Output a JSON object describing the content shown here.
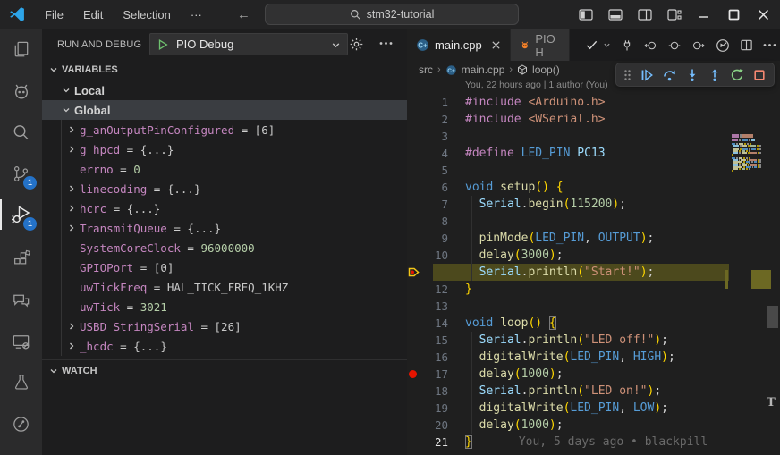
{
  "window": {
    "menus": [
      "File",
      "Edit",
      "Selection",
      "···"
    ],
    "search_label": "stm32-tutorial"
  },
  "activity_bar": {
    "badges": {
      "scm": "1",
      "debug": "1"
    },
    "icons": [
      "files",
      "platformio-alien",
      "search",
      "source-control",
      "run-and-debug",
      "extensions",
      "comments",
      "remote-explorer",
      "testing-beaker",
      "share-circle"
    ]
  },
  "sidebar": {
    "title": "RUN AND DEBUG",
    "launch_config": "PIO Debug",
    "sections": {
      "variables": "VARIABLES",
      "watch": "WATCH"
    },
    "scopes": [
      {
        "label": "Local",
        "selected": false
      },
      {
        "label": "Global",
        "selected": true
      }
    ],
    "variables": [
      {
        "expand": true,
        "name": "g_anOutputPinConfigured",
        "value": "[6]",
        "vclass": "plain"
      },
      {
        "expand": true,
        "name": "g_hpcd",
        "value": "{...}",
        "vclass": "plain"
      },
      {
        "expand": false,
        "name": "errno",
        "value": "0",
        "vclass": "num"
      },
      {
        "expand": true,
        "name": "linecoding",
        "value": "{...}",
        "vclass": "plain"
      },
      {
        "expand": true,
        "name": "hcrc",
        "value": "{...}",
        "vclass": "plain"
      },
      {
        "expand": true,
        "name": "TransmitQueue",
        "value": "{...}",
        "vclass": "plain"
      },
      {
        "expand": false,
        "name": "SystemCoreClock",
        "value": "96000000",
        "vclass": "num"
      },
      {
        "expand": false,
        "name": "GPIOPort",
        "value": "[0]",
        "vclass": "plain"
      },
      {
        "expand": false,
        "name": "uwTickFreq",
        "value": "HAL_TICK_FREQ_1KHZ",
        "vclass": "plain"
      },
      {
        "expand": false,
        "name": "uwTick",
        "value": "3021",
        "vclass": "num"
      },
      {
        "expand": true,
        "name": "USBD_StringSerial",
        "value": "[26]",
        "vclass": "plain"
      },
      {
        "expand": true,
        "name": "_hcdc",
        "value": "{...}",
        "vclass": "plain"
      }
    ]
  },
  "editor": {
    "tabs": [
      {
        "label": "main.cpp",
        "active": true
      },
      {
        "label": "PIO H",
        "active": false
      }
    ],
    "breadcrumbs": [
      "src",
      "main.cpp",
      "loop()"
    ],
    "codelens": "You, 22 hours ago | 1 author (You)",
    "current_line": 11,
    "breakpoint_line": 17,
    "cursor_line": 21,
    "ruler_label": "T",
    "lines": [
      {
        "n": 1,
        "t": [
          [
            "#include",
            "pp"
          ],
          [
            " ",
            "pun"
          ],
          [
            "<Arduino.h>",
            "str"
          ]
        ]
      },
      {
        "n": 2,
        "t": [
          [
            "#include",
            "pp"
          ],
          [
            " ",
            "pun"
          ],
          [
            "<WSerial.h>",
            "str"
          ]
        ]
      },
      {
        "n": 3,
        "t": []
      },
      {
        "n": 4,
        "t": [
          [
            "#define",
            "pp"
          ],
          [
            " ",
            "pun"
          ],
          [
            "LED_PIN",
            "kw"
          ],
          [
            " ",
            "pun"
          ],
          [
            "PC13",
            "var"
          ]
        ]
      },
      {
        "n": 5,
        "t": []
      },
      {
        "n": 6,
        "t": [
          [
            "void",
            "kw"
          ],
          [
            " ",
            "pun"
          ],
          [
            "setup",
            "fn"
          ],
          [
            "()",
            "br"
          ],
          [
            " ",
            "pun"
          ],
          [
            "{",
            "br"
          ]
        ]
      },
      {
        "n": 7,
        "t": [
          [
            "  ",
            "ind"
          ],
          [
            "Serial",
            "var"
          ],
          [
            ".",
            "pun"
          ],
          [
            "begin",
            "fn"
          ],
          [
            "(",
            "br"
          ],
          [
            "115200",
            "num"
          ],
          [
            ")",
            "br"
          ],
          [
            ";",
            "pun"
          ]
        ]
      },
      {
        "n": 8,
        "t": [
          [
            "  ",
            "ind"
          ]
        ]
      },
      {
        "n": 9,
        "t": [
          [
            "  ",
            "ind"
          ],
          [
            "pinMode",
            "fn"
          ],
          [
            "(",
            "br"
          ],
          [
            "LED_PIN",
            "kw"
          ],
          [
            ", ",
            "pun"
          ],
          [
            "OUTPUT",
            "kw"
          ],
          [
            ")",
            "br"
          ],
          [
            ";",
            "pun"
          ]
        ]
      },
      {
        "n": 10,
        "t": [
          [
            "  ",
            "ind"
          ],
          [
            "delay",
            "fn"
          ],
          [
            "(",
            "br"
          ],
          [
            "3000",
            "num"
          ],
          [
            ")",
            "br"
          ],
          [
            ";",
            "pun"
          ]
        ]
      },
      {
        "n": 11,
        "t": [
          [
            "  ",
            "ind"
          ],
          [
            "Serial",
            "var"
          ],
          [
            ".",
            "pun"
          ],
          [
            "println",
            "fn"
          ],
          [
            "(",
            "br"
          ],
          [
            "\"Start!\"",
            "str"
          ],
          [
            ")",
            "br"
          ],
          [
            ";",
            "pun"
          ]
        ]
      },
      {
        "n": 12,
        "t": [
          [
            "}",
            "br"
          ]
        ]
      },
      {
        "n": 13,
        "t": []
      },
      {
        "n": 14,
        "t": [
          [
            "void",
            "kw"
          ],
          [
            " ",
            "pun"
          ],
          [
            "loop",
            "fn"
          ],
          [
            "()",
            "br"
          ],
          [
            " ",
            "pun"
          ],
          [
            "{",
            "brbox"
          ]
        ]
      },
      {
        "n": 15,
        "t": [
          [
            "  ",
            "ind"
          ],
          [
            "Serial",
            "var"
          ],
          [
            ".",
            "pun"
          ],
          [
            "println",
            "fn"
          ],
          [
            "(",
            "br"
          ],
          [
            "\"LED off!\"",
            "str"
          ],
          [
            ")",
            "br"
          ],
          [
            ";",
            "pun"
          ]
        ]
      },
      {
        "n": 16,
        "t": [
          [
            "  ",
            "ind"
          ],
          [
            "digitalWrite",
            "fn"
          ],
          [
            "(",
            "br"
          ],
          [
            "LED_PIN",
            "kw"
          ],
          [
            ", ",
            "pun"
          ],
          [
            "HIGH",
            "kw"
          ],
          [
            ")",
            "br"
          ],
          [
            ";",
            "pun"
          ]
        ]
      },
      {
        "n": 17,
        "t": [
          [
            "  ",
            "ind"
          ],
          [
            "delay",
            "fn"
          ],
          [
            "(",
            "br"
          ],
          [
            "1000",
            "num"
          ],
          [
            ")",
            "br"
          ],
          [
            ";",
            "pun"
          ]
        ]
      },
      {
        "n": 18,
        "t": [
          [
            "  ",
            "ind"
          ],
          [
            "Serial",
            "var"
          ],
          [
            ".",
            "pun"
          ],
          [
            "println",
            "fn"
          ],
          [
            "(",
            "br"
          ],
          [
            "\"LED on!\"",
            "str"
          ],
          [
            ")",
            "br"
          ],
          [
            ";",
            "pun"
          ]
        ]
      },
      {
        "n": 19,
        "t": [
          [
            "  ",
            "ind"
          ],
          [
            "digitalWrite",
            "fn"
          ],
          [
            "(",
            "br"
          ],
          [
            "LED_PIN",
            "kw"
          ],
          [
            ", ",
            "pun"
          ],
          [
            "LOW",
            "kw"
          ],
          [
            ")",
            "br"
          ],
          [
            ";",
            "pun"
          ]
        ]
      },
      {
        "n": 20,
        "t": [
          [
            "  ",
            "ind"
          ],
          [
            "delay",
            "fn"
          ],
          [
            "(",
            "br"
          ],
          [
            "1000",
            "num"
          ],
          [
            ")",
            "br"
          ],
          [
            ";",
            "pun"
          ]
        ]
      },
      {
        "n": 21,
        "t": [
          [
            "}",
            "brbox"
          ]
        ],
        "blame": "You, 5 days ago • blackpill"
      }
    ]
  },
  "colors": {
    "keyword_blue": "#569cd6",
    "preprocessor_pink": "#c586c0",
    "string_orange": "#ce9178",
    "function_yellow": "#dcdcaa",
    "variable_lightblue": "#9cdcfe",
    "number_green": "#b5cea8",
    "bracket_gold": "#ffd700",
    "current_line_bg": "#4c491d",
    "breakpoint_red": "#e51400",
    "badge_blue": "#2472c8",
    "debug_icon_blue": "#75beff",
    "restart_green": "#89d185",
    "stop_red": "#f48771",
    "pio_orange": "#f5822a"
  }
}
